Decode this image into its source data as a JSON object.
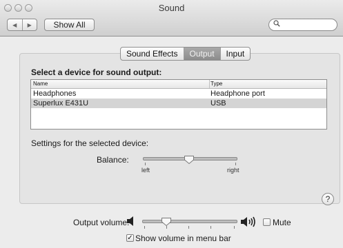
{
  "window": {
    "title": "Sound"
  },
  "toolbar": {
    "back_icon": "◀",
    "forward_icon": "▶",
    "show_all_label": "Show All",
    "search_placeholder": "",
    "search_icon": "🔍"
  },
  "tabs": [
    {
      "label": "Sound Effects",
      "selected": false
    },
    {
      "label": "Output",
      "selected": true
    },
    {
      "label": "Input",
      "selected": false
    }
  ],
  "output": {
    "select_device_label": "Select a device for sound output:",
    "columns": {
      "name": "Name",
      "type": "Type"
    },
    "devices": [
      {
        "name": "Headphones",
        "type": "Headphone port",
        "selected": false
      },
      {
        "name": "Superlux E431U",
        "type": "USB",
        "selected": true
      }
    ],
    "settings_label": "Settings for the selected device:",
    "balance": {
      "label": "Balance:",
      "left_label": "left",
      "right_label": "right",
      "value": 0.5
    }
  },
  "help": {
    "label": "?"
  },
  "volume": {
    "label": "Output volume:",
    "value": 0.22,
    "mute_label": "Mute",
    "mute_checked": false,
    "show_in_menubar_label": "Show volume in menu bar",
    "show_in_menubar_checked": true,
    "checked_glyph": "✓"
  },
  "colors": {
    "selected_row": "#d4d4d4",
    "selected_tab": "#8c8c8c",
    "window_bg": "#ececec"
  }
}
